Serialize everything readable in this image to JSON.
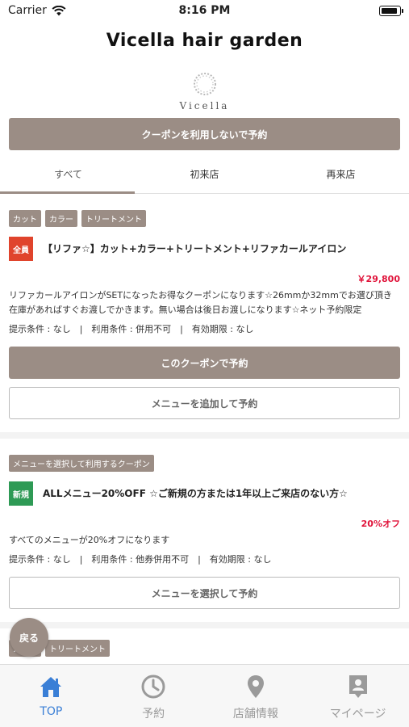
{
  "status_bar": {
    "carrier": "Carrier",
    "time": "8:16 PM"
  },
  "nav": {
    "title": "Vicella hair garden"
  },
  "logo": {
    "text": "Vicella"
  },
  "no_coupon_button": "クーポンを利用しないで予約",
  "tabs": [
    {
      "label": "すべて"
    },
    {
      "label": "初来店"
    },
    {
      "label": "再来店"
    }
  ],
  "coupons": [
    {
      "tags": [
        "カット",
        "カラー",
        "トリートメント"
      ],
      "badge": "全員",
      "title": "【リファ☆】カット+カラー+トリートメント+リファカールアイロン",
      "price": "￥29,800",
      "description": "リファカールアイロンがSETになったお得なクーポンになります☆26mmか32mmでお選び頂き在庫があればすぐお渡しでかきます。無い場合は後日お渡しになります☆ネット予約限定",
      "terms": "提示条件 : なし　|　利用条件 : 併用不可　|　有効期限 : なし",
      "primary_button": "このクーポンで予約",
      "secondary_button": "メニューを追加して予約"
    },
    {
      "tags": [
        "メニューを選択して利用するクーポン"
      ],
      "badge": "新規",
      "title": "ALLメニュー20%OFF ☆ご新規の方または1年以上ご来店のない方☆",
      "price": "20%オフ",
      "description": "すべてのメニューが20%オフになります",
      "terms": "提示条件 : なし　|　利用条件 : 他券併用不可　|　有効期限 : なし",
      "secondary_button": "メニューを選択して予約"
    },
    {
      "tags": [
        "カラー",
        "トリートメント"
      ]
    }
  ],
  "back_button": "戻る",
  "tab_bar": [
    {
      "label": "TOP",
      "icon": "home-icon",
      "active": true
    },
    {
      "label": "予約",
      "icon": "clock-icon"
    },
    {
      "label": "店舗情報",
      "icon": "location-pin-icon"
    },
    {
      "label": "マイページ",
      "icon": "contact-card-icon"
    }
  ],
  "colors": {
    "accent": "#9b8d85",
    "price": "#e0133a",
    "active_tab": "#3a7fd6",
    "badge_all": "#e0442c",
    "badge_new": "#2e9a55"
  }
}
